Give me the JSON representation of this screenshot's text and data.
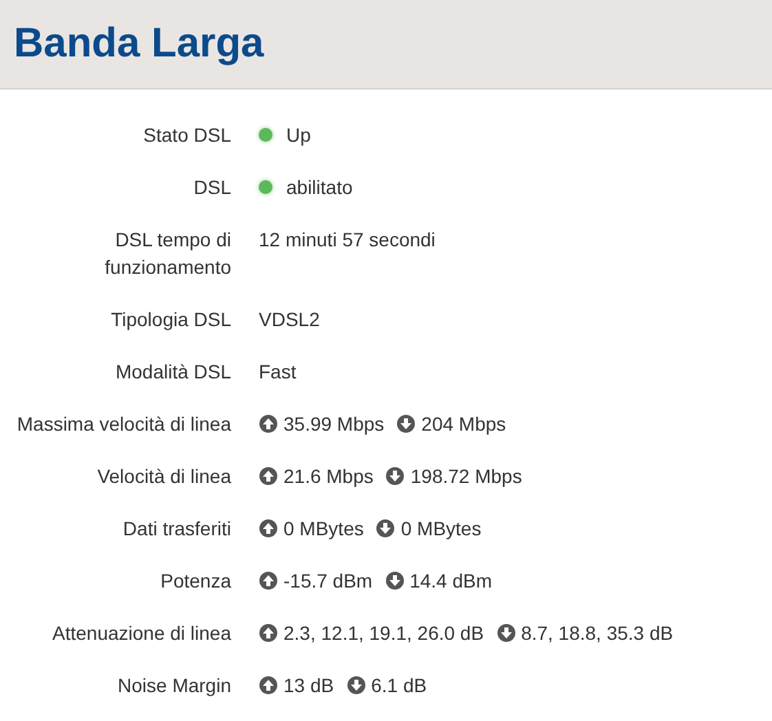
{
  "title": "Banda Larga",
  "rows": [
    {
      "kind": "status",
      "label": "Stato DSL",
      "color": "#5cb85c",
      "value": "Up"
    },
    {
      "kind": "status",
      "label": "DSL",
      "color": "#5cb85c",
      "value": "abilitato"
    },
    {
      "kind": "text",
      "label": "DSL tempo di funzionamento",
      "value": "12 minuti 57 secondi"
    },
    {
      "kind": "text",
      "label": "Tipologia DSL",
      "value": "VDSL2"
    },
    {
      "kind": "text",
      "label": "Modalità DSL",
      "value": "Fast"
    },
    {
      "kind": "updown",
      "label": "Massima velocità di linea",
      "up": "35.99 Mbps",
      "down": "204 Mbps"
    },
    {
      "kind": "updown",
      "label": "Velocità di linea",
      "up": "21.6 Mbps",
      "down": "198.72 Mbps"
    },
    {
      "kind": "updown",
      "label": "Dati trasferiti",
      "up": "0 MBytes",
      "down": "0 MBytes"
    },
    {
      "kind": "updown",
      "label": "Potenza",
      "up": "-15.7 dBm",
      "down": "14.4 dBm"
    },
    {
      "kind": "updown",
      "label": "Attenuazione di linea",
      "up": "2.3, 12.1, 19.1, 26.0 dB",
      "down": "8.7, 18.8, 35.3 dB"
    },
    {
      "kind": "updown",
      "label": "Noise Margin",
      "up": "13 dB",
      "down": "6.1 dB"
    }
  ]
}
